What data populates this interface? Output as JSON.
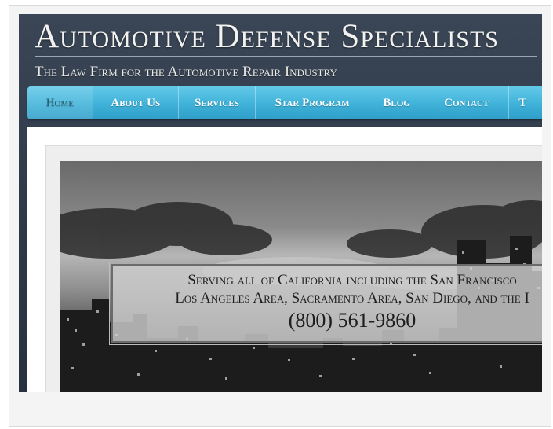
{
  "header": {
    "site_title": "Automotive Defense Specialists",
    "tagline": "The Law Firm for the Automotive Repair Industry"
  },
  "nav": {
    "items": [
      {
        "label": "Home",
        "active": true
      },
      {
        "label": "About Us"
      },
      {
        "label": "Services"
      },
      {
        "label": "Star Program"
      },
      {
        "label": "Blog"
      },
      {
        "label": "Contact"
      },
      {
        "label": "T"
      }
    ]
  },
  "hero": {
    "banner_line1": "Serving all of California including the San Francisco",
    "banner_line2": "Los Angeles Area, Sacramento Area, San Diego, and the I",
    "phone": "(800) 561-9860"
  },
  "colors": {
    "header_bg": "#2d3847",
    "nav_bg": "#3fb2d9",
    "nav_active_text": "#2a5a70"
  }
}
